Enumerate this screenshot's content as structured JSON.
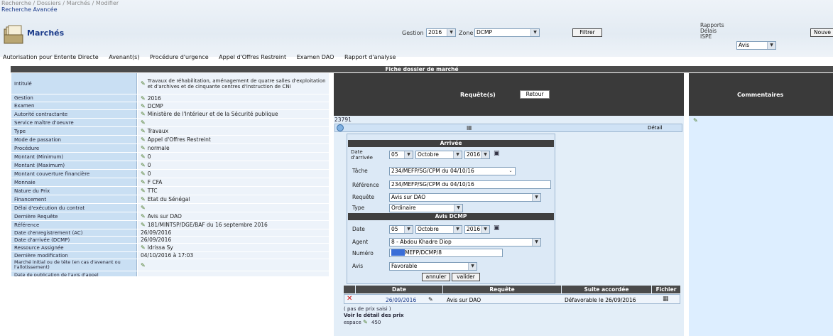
{
  "breadcrumb": {
    "line1": "Recherche / Dossiers / Marchés / Modifier",
    "line2": "Recherche Avancée"
  },
  "app": {
    "title": "Marchés"
  },
  "filters": {
    "gestion_label": "Gestion",
    "gestion_value": "2016",
    "zone_label": "Zone",
    "zone_value": "DCMP",
    "filtrer_label": "Filtrer"
  },
  "rapports": {
    "line1": "Rapports",
    "line2": "Délais",
    "line3": "ISPE",
    "select_value": "Avis",
    "nouveau_label": "Nouve"
  },
  "menu": [
    "Autorisation pour Entente Directe",
    "Avenant(s)",
    "Procédure d'urgence",
    "Appel d'Offres Restreint",
    "Examen DAO",
    "Rapport d'analyse"
  ],
  "fiche_title": "Fiche dossier de marché",
  "fields": [
    {
      "label": "Intitulé",
      "value": "Travaux de réhabilitation, aménagement de quatre salles d'exploitation et d'archives et de cinquante centres d'instruction de CNI"
    },
    {
      "label": "Gestion",
      "value": "2016"
    },
    {
      "label": "Examen",
      "value": "DCMP"
    },
    {
      "label": "Autorité contractante",
      "value": "Ministère de l'Intérieur et de la Sécurité publique"
    },
    {
      "label": "Service maître d'oeuvre",
      "value": ""
    },
    {
      "label": "Type",
      "value": "Travaux"
    },
    {
      "label": "Mode de passation",
      "value": "Appel d'Offres Restreint"
    },
    {
      "label": "Procédure",
      "value": "normale"
    },
    {
      "label": "Montant (Minimum)",
      "value": "0"
    },
    {
      "label": "Montant (Maximum)",
      "value": "0"
    },
    {
      "label": "Montant couverture financière",
      "value": "0"
    },
    {
      "label": "Monnaie",
      "value": "F CFA"
    },
    {
      "label": "Nature du Prix",
      "value": "TTC"
    },
    {
      "label": "Financement",
      "value": "Etat du Sénégal"
    },
    {
      "label": "Délai d'exécution du contrat",
      "value": ""
    },
    {
      "label": "Dernière Requête",
      "value": "Avis sur DAO"
    },
    {
      "label": "Référence",
      "value": "181/MINTSP/DGE/BAF du 16 septembre 2016"
    },
    {
      "label": "Date d'enregistrement (AC)",
      "value": "26/09/2016"
    },
    {
      "label": "Date d'arrivée (DCMP)",
      "value": "26/09/2016"
    },
    {
      "label": "Ressource Assignée",
      "value": "Idrissa Sy"
    },
    {
      "label": "Dernière modification",
      "value": "04/10/2016 à 17:03"
    },
    {
      "label": "Marché initial ou de tête (en cas d'avenant ou l'allotissement)",
      "value": ""
    },
    {
      "label": "Date de publication de l'avis d'appel",
      "value": ""
    }
  ],
  "requetes": {
    "header": "Requête(s)",
    "retour_label": "Retour",
    "id": "23791",
    "detail_label": "Détail",
    "arrivee": {
      "title": "Arrivée",
      "date_label": "Date d'arrivée",
      "day": "05",
      "month": "Octobre",
      "year": "2016",
      "tache_label": "Tâche",
      "tache_value": "234/MEFP/SG/CPM du 04/10/16",
      "reference_label": "Référence",
      "reference_value": "234/MEFP/SG/CPM du 04/10/16",
      "requete_label": "Requête",
      "requete_value": "Avis sur DAO",
      "type_label": "Type",
      "type_value": "Ordinaire"
    },
    "avis": {
      "title": "Avis DCMP",
      "date_label": "Date",
      "day": "05",
      "month": "Octobre",
      "year": "2016",
      "agent_label": "Agent",
      "agent_value": "8 - Abdou Khadre Diop",
      "numero_label": "Numéro",
      "numero_highlight": "0000",
      "numero_value": "MEFP/DCMP/8",
      "avis_label": "Avis",
      "avis_value": "Favorable",
      "annuler_label": "annuler",
      "valider_label": "valider"
    },
    "table": {
      "headers": [
        "Date",
        "Requête",
        "Suite accordée",
        "Fichier"
      ],
      "row": {
        "date": "26/09/2016",
        "requete": "Avis sur DAO",
        "suite": "Défavorable le 26/09/2016"
      }
    },
    "pas_de_prix": "( pas de prix saisi )",
    "voir_detail": "Voir le détail des prix",
    "espace_label": "espace",
    "espace_value": "450"
  },
  "commentaires": {
    "header": "Commentaires"
  }
}
